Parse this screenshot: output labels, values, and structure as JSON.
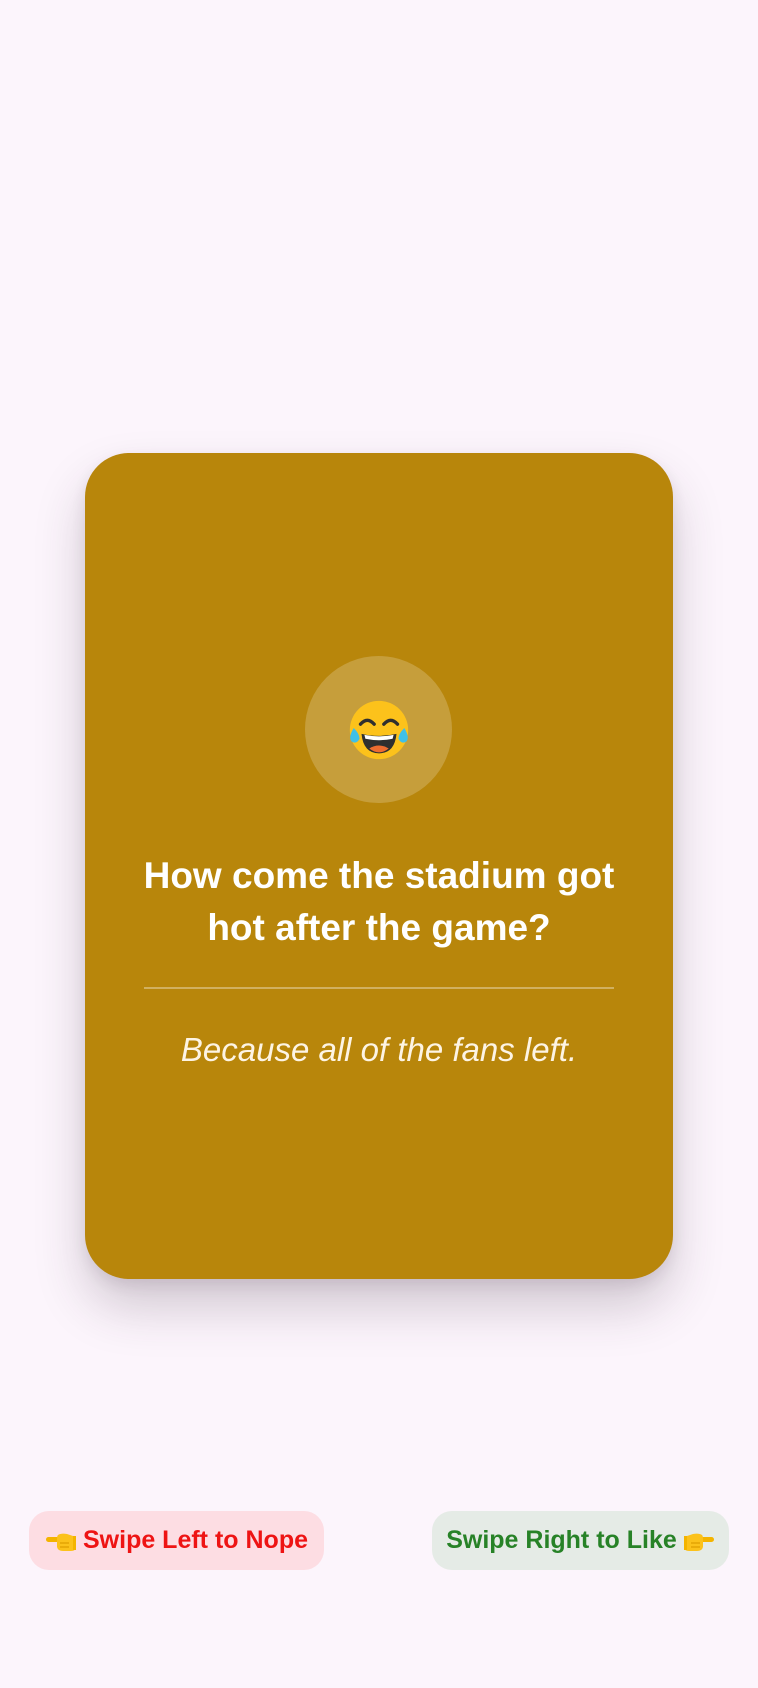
{
  "card": {
    "emoji": "face-with-tears-of-joy",
    "question": "How come the stadium got hot after the game?",
    "answer": "Because all of the fans left.",
    "background_color": "#b8860b"
  },
  "actions": {
    "left_label": "Swipe Left to Nope",
    "left_icon": "pointing-left-hand-icon",
    "left_color": "#ee1414",
    "right_label": "Swipe Right to Like",
    "right_icon": "pointing-right-hand-icon",
    "right_color": "#278227"
  }
}
